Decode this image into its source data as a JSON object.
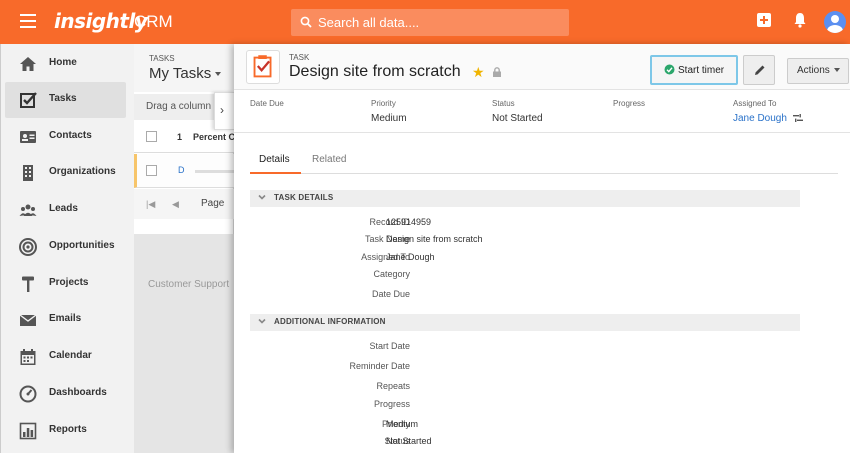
{
  "app": {
    "brand": "insightly",
    "product": "CRM"
  },
  "search": {
    "placeholder": "Search all data...."
  },
  "sidebar": {
    "items": [
      {
        "label": "Home",
        "icon": "home-icon"
      },
      {
        "label": "Tasks",
        "icon": "checkbox-icon",
        "active": true
      },
      {
        "label": "Contacts",
        "icon": "contact-card-icon"
      },
      {
        "label": "Organizations",
        "icon": "building-icon"
      },
      {
        "label": "Leads",
        "icon": "people-icon"
      },
      {
        "label": "Opportunities",
        "icon": "target-icon"
      },
      {
        "label": "Projects",
        "icon": "hammer-icon"
      },
      {
        "label": "Emails",
        "icon": "envelope-icon"
      },
      {
        "label": "Calendar",
        "icon": "calendar-icon"
      },
      {
        "label": "Dashboards",
        "icon": "gauge-icon"
      },
      {
        "label": "Reports",
        "icon": "report-icon"
      }
    ]
  },
  "task_list": {
    "kicker": "TASKS",
    "title": "My Tasks",
    "drag_hint": "Drag a column h",
    "columns": {
      "num": "1",
      "percent": "Percent C"
    },
    "row_link": "D",
    "pager_label": "Page"
  },
  "footer": {
    "support": "Customer Support"
  },
  "detail": {
    "kicker": "TASK",
    "title": "Design site from scratch",
    "buttons": {
      "timer": "Start timer",
      "actions": "Actions"
    },
    "summary": [
      {
        "key": "Date Due",
        "value": ""
      },
      {
        "key": "Priority",
        "value": "Medium"
      },
      {
        "key": "Status",
        "value": "Not Started"
      },
      {
        "key": "Progress",
        "value": ""
      },
      {
        "key": "Assigned To",
        "value": "Jane Dough"
      }
    ],
    "tabs": [
      "Details",
      "Related"
    ],
    "sections": [
      {
        "title": "TASK DETAILS",
        "fields": [
          {
            "label": "Record ID",
            "value": "125914959"
          },
          {
            "label": "Task Name",
            "value": "Design site from scratch"
          },
          {
            "label": "Assigned To",
            "value": "Jane Dough"
          },
          {
            "label": "Category",
            "value": ""
          },
          {
            "label": "Date Due",
            "value": ""
          }
        ]
      },
      {
        "title": "ADDITIONAL INFORMATION",
        "fields": [
          {
            "label": "Start Date",
            "value": ""
          },
          {
            "label": "Reminder Date",
            "value": ""
          },
          {
            "label": "Repeats",
            "value": ""
          },
          {
            "label": "Progress",
            "value": ""
          },
          {
            "label": "Priority",
            "value": "Medium"
          },
          {
            "label": "Status",
            "value": "Not Started"
          }
        ]
      }
    ]
  },
  "colors": {
    "brand": "#f86a2a",
    "link": "#2a72c9",
    "star": "#f0b400",
    "timer_border": "#7dc7e8"
  }
}
